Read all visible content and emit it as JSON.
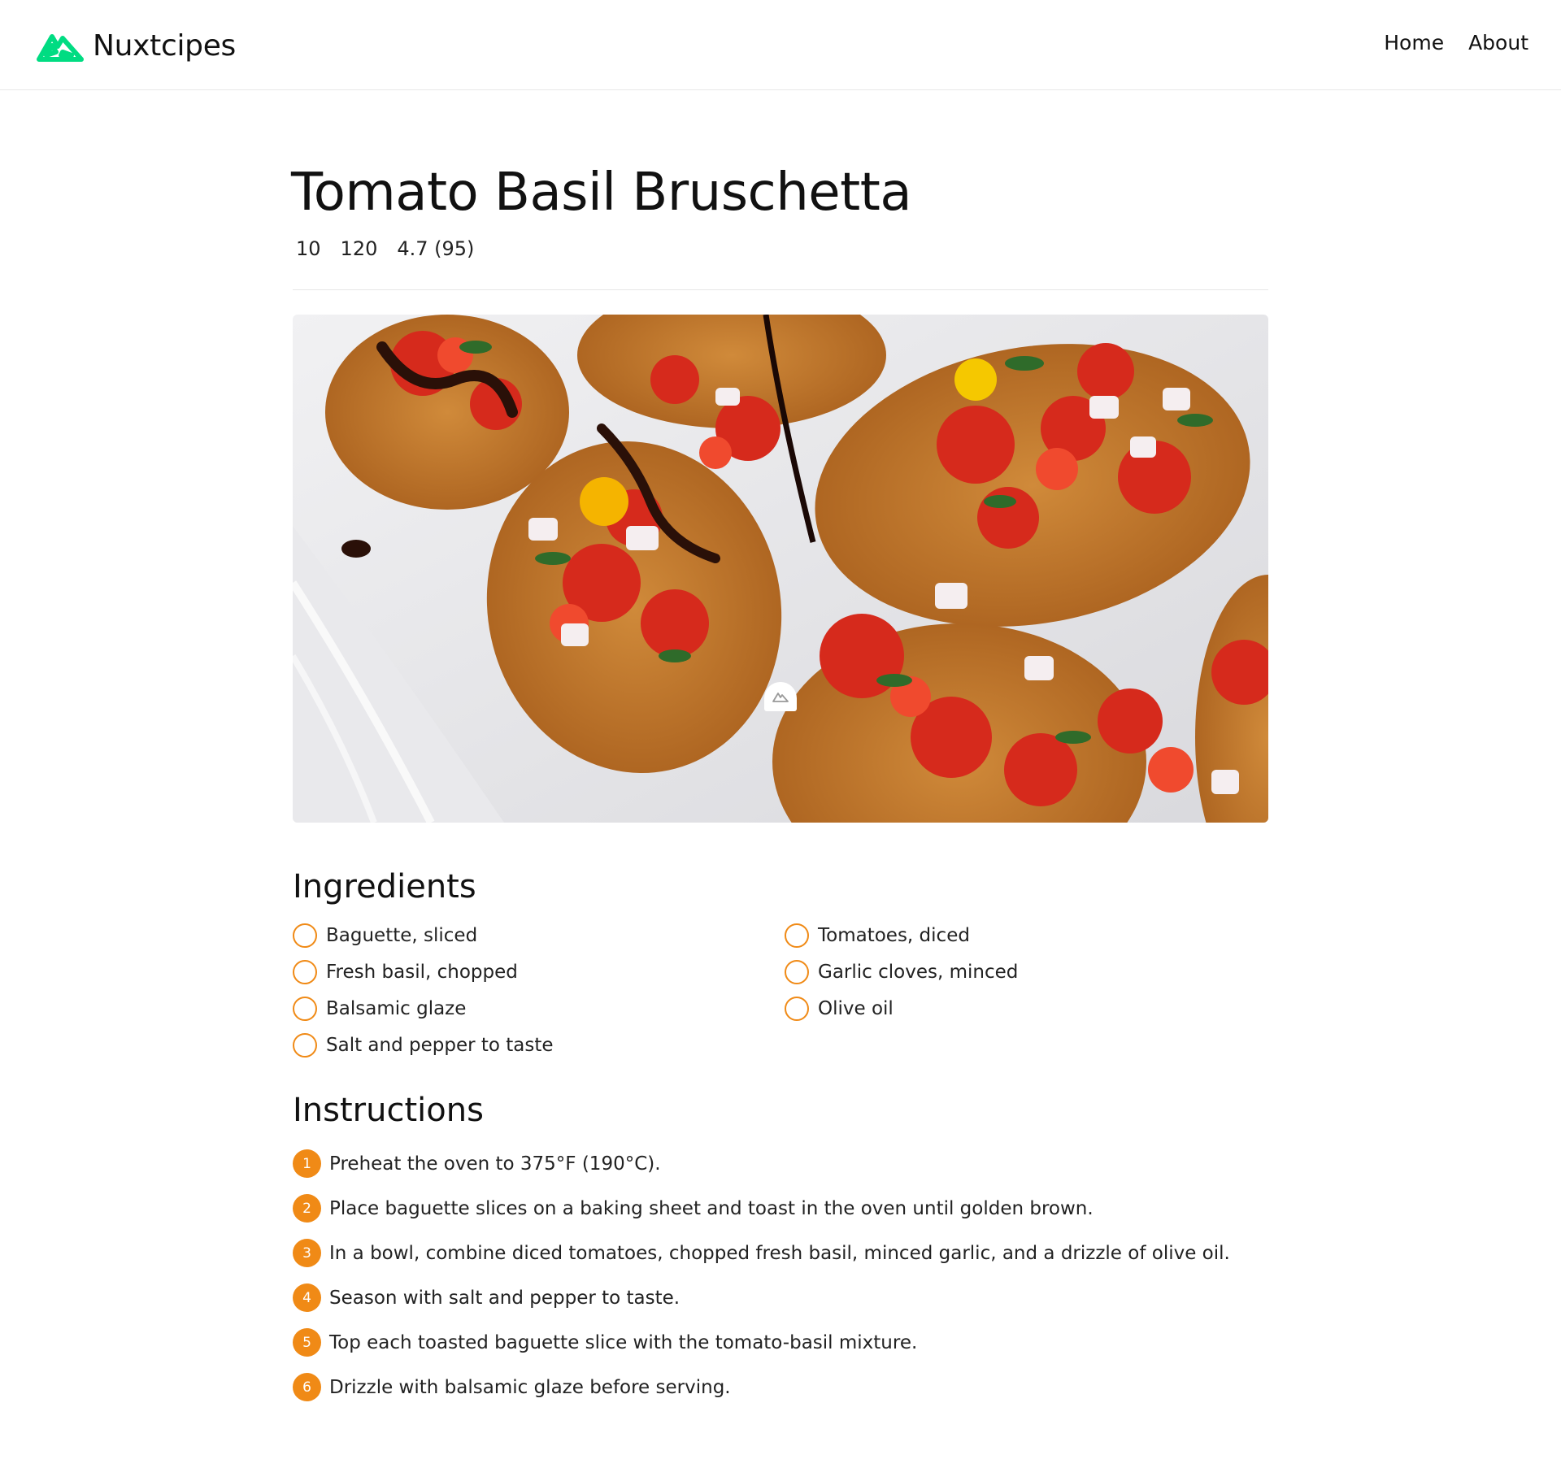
{
  "header": {
    "brand": "Nuxtcipes",
    "logo_icon": "nuxt-mountain-icon",
    "logo_color": "#00DC82",
    "nav": [
      {
        "label": "Home"
      },
      {
        "label": "About"
      }
    ]
  },
  "recipe": {
    "title": "Tomato Basil Bruschetta",
    "meta": {
      "prep": "10",
      "calories": "120",
      "rating": "4.7 (95)"
    },
    "image_badge_icon": "nuxt-logo-icon",
    "ingredients_heading": "Ingredients",
    "ingredients": [
      "Baguette, sliced",
      "Tomatoes, diced",
      "Fresh basil, chopped",
      "Garlic cloves, minced",
      "Balsamic glaze",
      "Olive oil",
      "Salt and pepper to taste"
    ],
    "instructions_heading": "Instructions",
    "instructions": [
      {
        "num": "1",
        "text": "Preheat the oven to 375°F (190°C)."
      },
      {
        "num": "2",
        "text": "Place baguette slices on a baking sheet and toast in the oven until golden brown."
      },
      {
        "num": "3",
        "text": "In a bowl, combine diced tomatoes, chopped fresh basil, minced garlic, and a drizzle of olive oil."
      },
      {
        "num": "4",
        "text": "Season with salt and pepper to taste."
      },
      {
        "num": "5",
        "text": "Top each toasted baguette slice with the tomato-basil mixture."
      },
      {
        "num": "6",
        "text": "Drizzle with balsamic glaze before serving."
      }
    ]
  },
  "colors": {
    "accent": "#F08A16",
    "brand": "#00DC82",
    "divider": "#E6E6E6"
  }
}
